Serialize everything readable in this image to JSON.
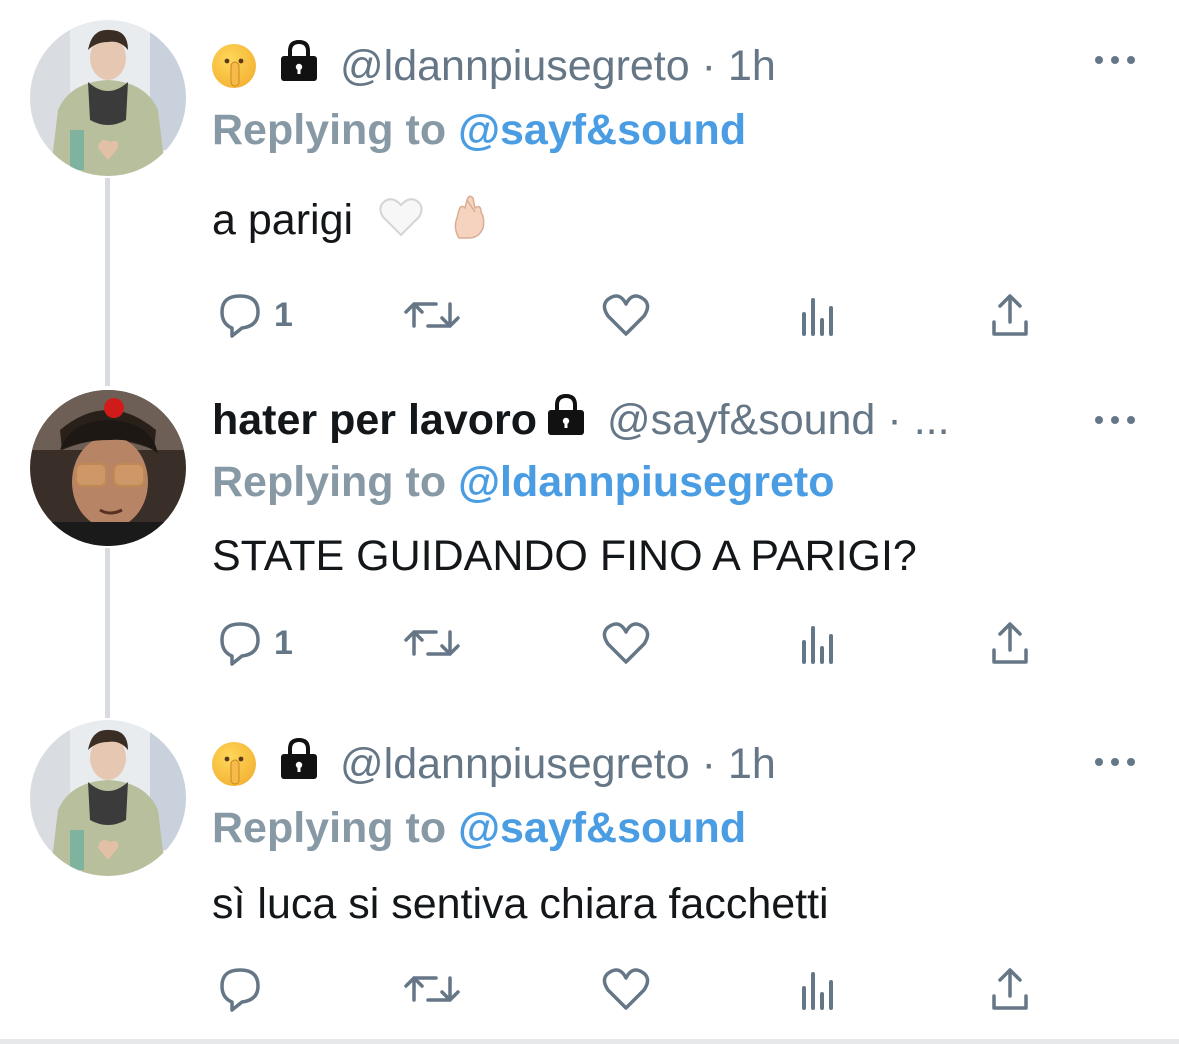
{
  "tweets": [
    {
      "name_emoji": "shushing-face",
      "display_name": "",
      "handle": "@ldannpiusegreto",
      "separator": "·",
      "time": "1h",
      "reply_prefix": "Replying to",
      "reply_target": "@sayf&sound",
      "text": "a parigi",
      "text_emojis": [
        "white-heart",
        "crossed-fingers"
      ],
      "reply_count": "1"
    },
    {
      "display_name": "hater per lavoro",
      "handle": "@sayf&sound",
      "separator": "·",
      "time": "...",
      "reply_prefix": "Replying to",
      "reply_target": "@ldannpiusegreto",
      "text": "STATE GUIDANDO FINO A PARIGI?",
      "reply_count": "1"
    },
    {
      "name_emoji": "shushing-face",
      "display_name": "",
      "handle": "@ldannpiusegreto",
      "separator": "·",
      "time": "1h",
      "reply_prefix": "Replying to",
      "reply_target": "@sayf&sound",
      "text": "sì luca si sentiva chiara facchetti",
      "reply_count": ""
    }
  ],
  "colors": {
    "link": "#4a9de3",
    "muted": "#657786",
    "reply_prefix": "#8899a6",
    "thread_line": "#d8dbdf"
  }
}
